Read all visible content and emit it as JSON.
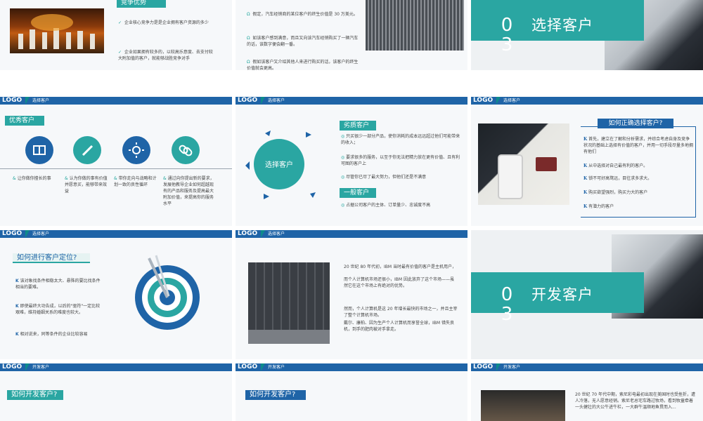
{
  "colors": {
    "bar": "#1f64a7",
    "teal": "#2aa6a2",
    "tealDark": "#0d8b8b",
    "blue": "#1f64a7"
  },
  "s1": {
    "heading": "竞争优势",
    "b1": "企业核心竞争力是是企业拥有客户资源的多少",
    "b2": "企业如果拥有较多的，以较高乐意度、去支付较大附加值的客户，就能够战胜竞争对手"
  },
  "s2": {
    "b1": "假定，汽车经销商的某位客户的终生价值是 30 万美元。",
    "b2": "如该客户感到满意，而且又向该汽车经销购买了一辆汽车的话，该数字便会翻一番。",
    "b3": "假如该客户又介绍其他人来进行购买的话，该客户的终生价值就会更高。"
  },
  "s3": {
    "num": "0\n3",
    "title": "选择客户"
  },
  "s4": {
    "logo": "LOGO",
    "sect": "选择客户",
    "chip": "优秀客户",
    "c1": "让你做你擅长的事",
    "c2": "认为你做的事有价值并愿意买，能够带来效益",
    "c3": "带你走向与战略和计划一致的良性循环",
    "c4": "通过向你提出新的要求，发展他教导企业如何超越现有的产品和服务及提高最大附加价值，来提高你的服务水平"
  },
  "s5": {
    "logo": "LOGO",
    "sect": "选择客户",
    "center": "选择客户",
    "h1": "劣质客户",
    "a1": "只买很少一部分产品，使你消耗的成本远远超过他们可能带来的收入；",
    "a2": "要求很多的服务，以至于你无法把精力放在更有价值、且有利可图的客户上",
    "a3": "尽管你已尽了最大努力，但他们还是不满意",
    "h2": "一般客户",
    "a4": "占据公司客户的主体、订单量少、忠诚度不高"
  },
  "s6": {
    "logo": "LOGO",
    "sect": "选择客户",
    "heading": "如何正确选择客户?",
    "l1": "首先，建立在了解和分析需求，并综合考虑自身及竞争状况的基础上选择有价值的客户，并用一切手段尽量多地拥有他们",
    "l2": "从中选择对自己最有利的客户。",
    "l3": "锁不可好高骛远，目往求多求大。",
    "l4": "购买欲望强烈，购买力大的客户",
    "l5": "有潜力的客户"
  },
  "s7": {
    "logo": "LOGO",
    "sect": "选择客户",
    "heading": "如何进行客户定位?",
    "l1": "该对象找条件相稳太大、悬殊的要比找条件相当的要难。",
    "l2": "即使最终大功告成，以后的\"驱符\"一定比较艰难，维持婚姻关系的难度也较大。",
    "l3": "相对说来，同等条件的企业比较容易"
  },
  "s8": {
    "logo": "LOGO",
    "sect": "选择客户",
    "p1": "20 世纪 80 年代初，IBM 当时最有价值的客户是主机用户，",
    "p2": "而个人计算机市场还很小，IBM 因此放弃了这个市场——虽然它在这个市场上有绝对的优势。",
    "p3": "然而，个人计算机是这 20 年增长最快的市场之一，并且主宰了整个计算机市场。",
    "p4": "戴尔、康柏、因为生产个人计算机而享誉全球，IBM 错失良机，到手的肥肉被对手拿走。"
  },
  "s9": {
    "num": "0\n3",
    "title": "开发客户"
  },
  "s10": {
    "logo": "LOGO",
    "sect": "开发客户",
    "chip": "如何开发客户?"
  },
  "s11": {
    "logo": "LOGO",
    "sect": "开发客户",
    "chip": "如何开发客户?"
  },
  "s12": {
    "logo": "LOGO",
    "sect": "开发客户",
    "p1": "20 世纪 70 年代中期，索尼彩电最初出现在美国时也受挫折，遭人冷落，无人愿意经销。索尼老总宅车路过牧场，看到牧童牵着一头健壮的大公牛进牛栏，一大群牛温顺地鱼贯而入..."
  }
}
